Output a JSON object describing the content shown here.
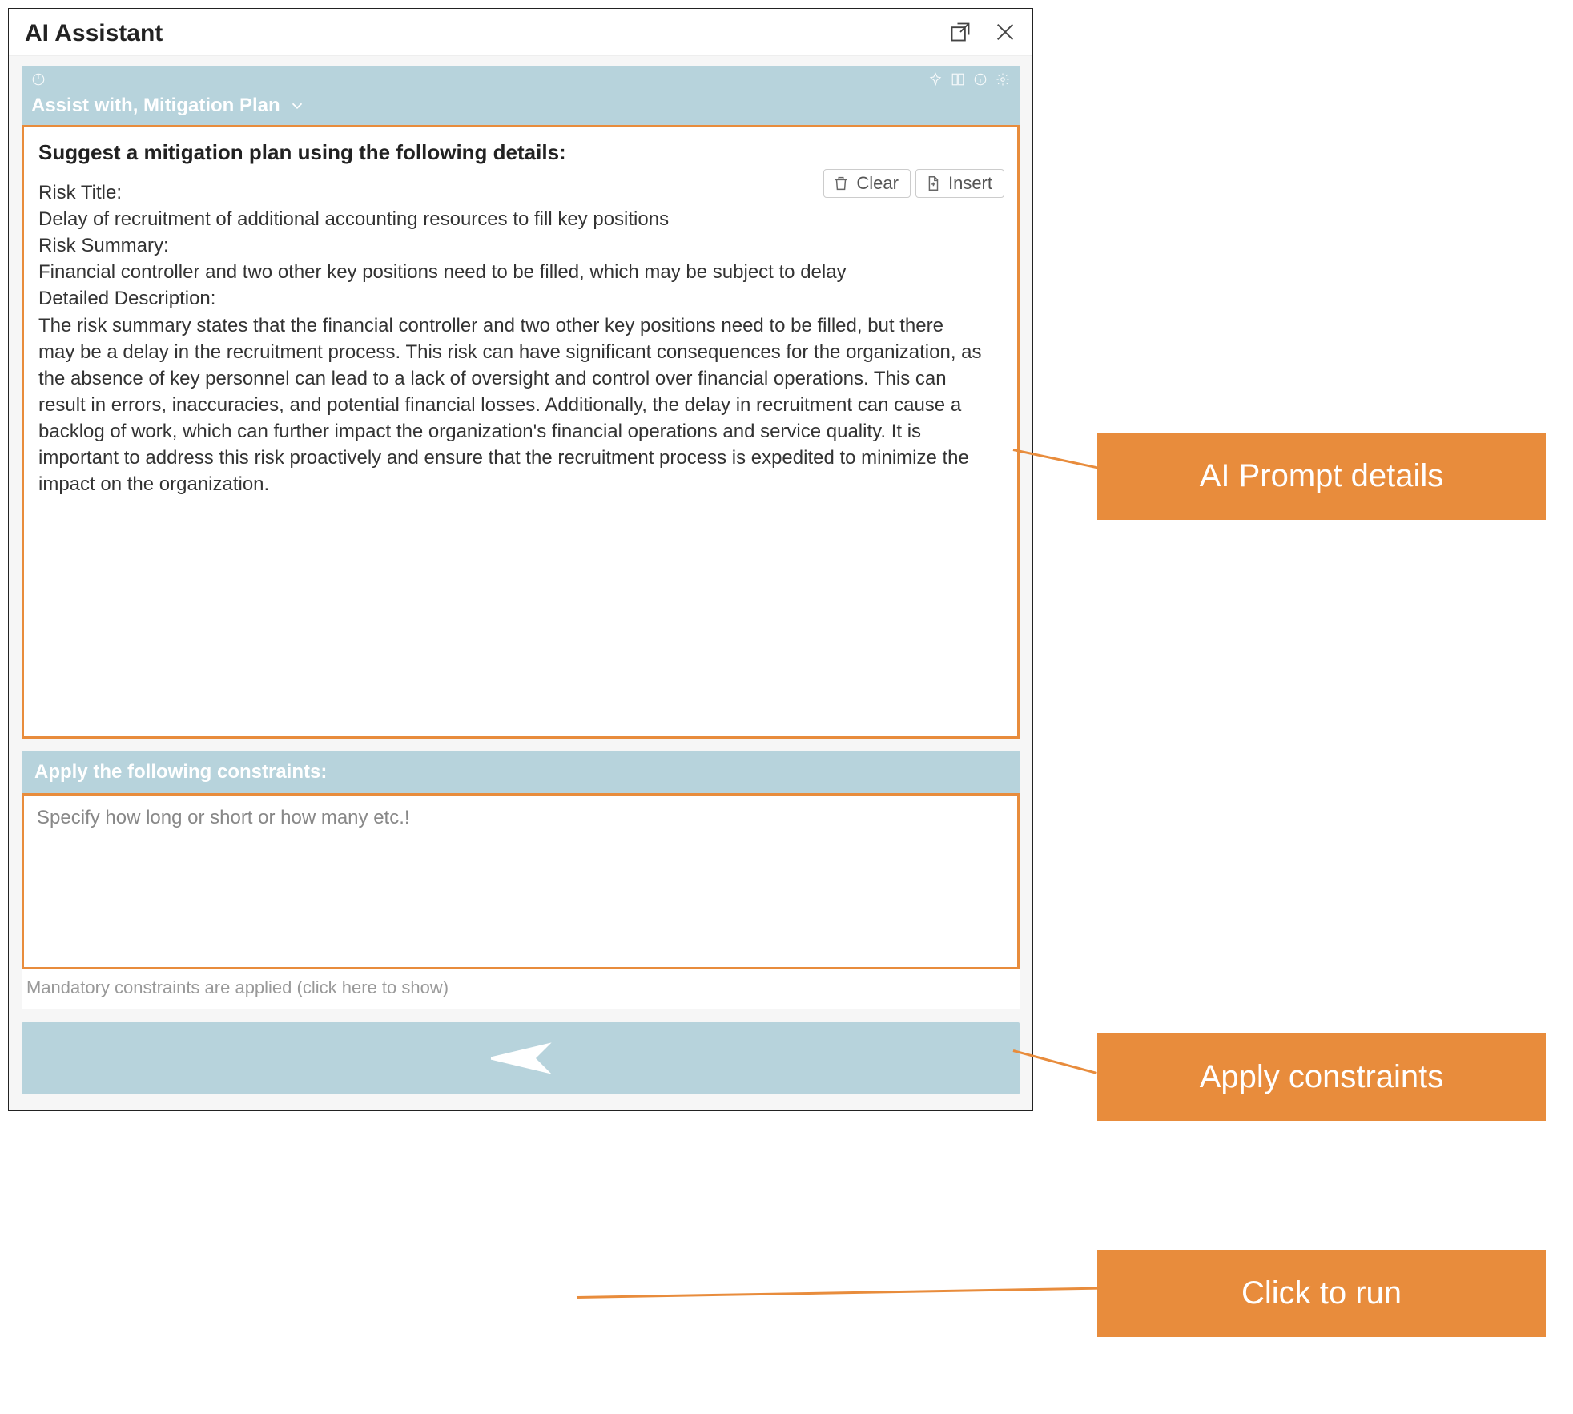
{
  "window": {
    "title": "AI Assistant"
  },
  "panel1": {
    "dropdown_label": "Assist with, Mitigation Plan",
    "prompt_title": "Suggest a mitigation plan using the following details:",
    "actions": {
      "clear": "Clear",
      "insert": "Insert"
    },
    "fields": {
      "risk_title_label": "Risk Title:",
      "risk_title_value": "Delay of recruitment of additional accounting resources to fill key positions",
      "risk_summary_label": "Risk Summary:",
      "risk_summary_value": "Financial controller and two other key positions need to be filled, which may be subject to delay",
      "detailed_desc_label": "Detailed Description:",
      "detailed_desc_value": "The risk summary states that the financial controller and two other key positions need to be filled, but there may be a delay in the recruitment process. This risk can have significant consequences for the organization, as the absence of key personnel can lead to a lack of oversight and control over financial operations. This can result in errors, inaccuracies, and potential financial losses. Additionally, the delay in recruitment can cause a backlog of work, which can further impact the organization's financial operations and service quality. It is important to address this risk proactively and ensure that the recruitment process is expedited to minimize the impact on the organization."
    }
  },
  "panel2": {
    "header": "Apply the following constraints:",
    "placeholder": "Specify how long or short or how many etc.!",
    "note": "Mandatory constraints are applied (click here to show)"
  },
  "callouts": {
    "c1": "AI Prompt details",
    "c2": "Apply constraints",
    "c3": "Click to run"
  }
}
